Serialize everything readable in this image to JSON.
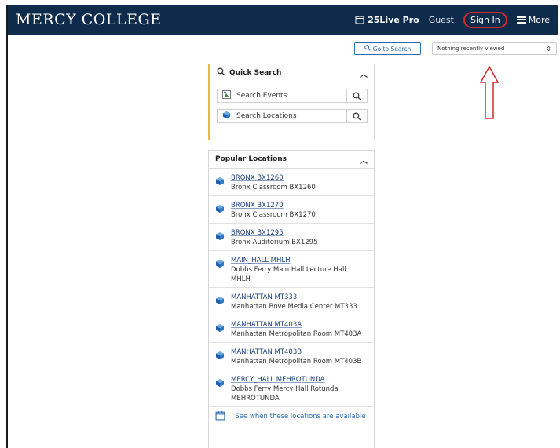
{
  "header": {
    "logo": "MERCY COLLEGE",
    "product": "25Live Pro",
    "guest": "Guest",
    "sign_in": "Sign In",
    "more": "More"
  },
  "toolbar": {
    "go_to_search": "Go to Search",
    "recently_viewed": "Nothing recently viewed"
  },
  "quick_search": {
    "title": "Quick Search",
    "items": [
      {
        "label": "Search Events",
        "icon": "events-icon"
      },
      {
        "label": "Search Locations",
        "icon": "locations-cube-icon"
      }
    ]
  },
  "popular_locations": {
    "title": "Popular Locations",
    "items": [
      {
        "code": "BRONX BX1260",
        "name": "Bronx Classroom BX1260"
      },
      {
        "code": "BRONX BX1270",
        "name": "Bronx Classroom BX1270"
      },
      {
        "code": "BRONX BX1295",
        "name": "Bronx Auditorium BX1295"
      },
      {
        "code": "MAIN_HALL MHLH",
        "name": "Dobbs Ferry Main Hall Lecture Hall MHLH"
      },
      {
        "code": "MANHATTAN MT333",
        "name": "Manhattan Bove Media Center MT333"
      },
      {
        "code": "MANHATTAN MT403A",
        "name": "Manhattan Metropolitan Room MT403A"
      },
      {
        "code": "MANHATTAN MT403B",
        "name": "Manhattan Metropolitan Room MT403B"
      },
      {
        "code": "MERCY_HALL MEHROTUNDA",
        "name": "Dobbs Ferry Mercy Hall Rotunda MEHROTUNDA"
      }
    ],
    "availability": "See when these locations are available"
  },
  "colors": {
    "header_bg": "#0f2b4c",
    "accent_blue": "#2b6cb0",
    "annotation_red": "#d42a2a",
    "quick_search_accent": "#e7b93e"
  }
}
